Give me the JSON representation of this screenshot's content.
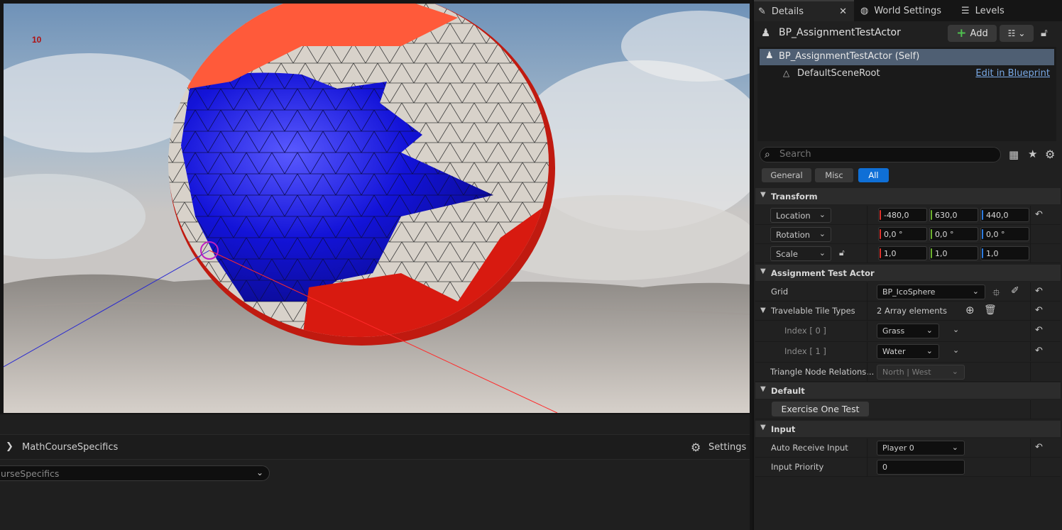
{
  "viewport": {
    "fps": "10"
  },
  "bottom_panel": {
    "title": "MathCourseSpecifics",
    "settings_label": "Settings",
    "combo_value": "urseSpecifics"
  },
  "tabs": [
    {
      "label": "Details"
    },
    {
      "label": "World Settings"
    },
    {
      "label": "Levels"
    }
  ],
  "details": {
    "actor_name": "BP_AssignmentTestActor",
    "add_label": "Add",
    "tree": {
      "self_label": "BP_AssignmentTestActor (Self)",
      "root_label": "DefaultSceneRoot",
      "edit_link": "Edit in Blueprint"
    },
    "search_placeholder": "Search",
    "filters": [
      "General",
      "Misc",
      "All"
    ],
    "sections": {
      "transform": "Transform",
      "assignment": "Assignment Test Actor",
      "default": "Default",
      "input": "Input"
    },
    "transform": {
      "location": {
        "label": "Location",
        "x": "-480,0",
        "y": "630,0",
        "z": "440,0"
      },
      "rotation": {
        "label": "Rotation",
        "x": "0,0 °",
        "y": "0,0 °",
        "z": "0,0 °"
      },
      "scale": {
        "label": "Scale",
        "x": "1,0",
        "y": "1,0",
        "z": "1,0"
      }
    },
    "assignment": {
      "grid_label": "Grid",
      "grid_value": "BP_IcoSphere",
      "tile_types_label": "Travelable Tile Types",
      "tile_types_count": "2 Array elements",
      "index0_label": "Index [ 0 ]",
      "index0_value": "Grass",
      "index1_label": "Index [ 1 ]",
      "index1_value": "Water",
      "triangle_label": "Triangle Node Relations...",
      "triangle_value": "North | West"
    },
    "default": {
      "button_label": "Exercise One Test"
    },
    "input": {
      "auto_label": "Auto Receive Input",
      "auto_value": "Player 0",
      "priority_label": "Input Priority",
      "priority_value": "0"
    }
  }
}
